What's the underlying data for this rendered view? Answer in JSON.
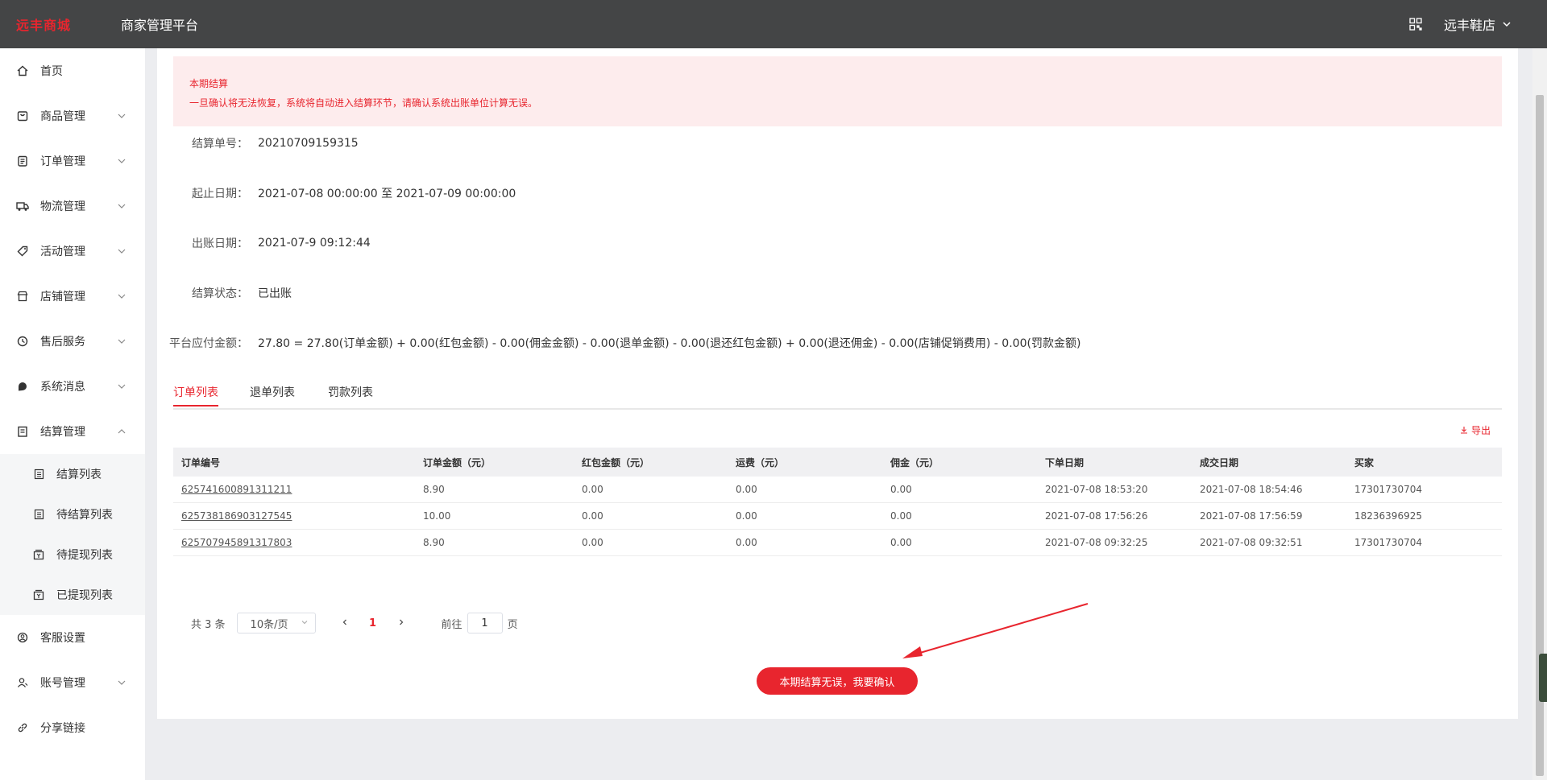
{
  "header": {
    "logo_text": "远丰商城",
    "platform_title": "商家管理平台",
    "store_name": "远丰鞋店"
  },
  "sidebar": {
    "items": [
      {
        "label": "首页",
        "icon": "home-icon"
      },
      {
        "label": "商品管理",
        "icon": "goods-icon"
      },
      {
        "label": "订单管理",
        "icon": "order-icon"
      },
      {
        "label": "物流管理",
        "icon": "truck-icon"
      },
      {
        "label": "活动管理",
        "icon": "tag-icon"
      },
      {
        "label": "店铺管理",
        "icon": "shop-icon"
      },
      {
        "label": "售后服务",
        "icon": "service-icon"
      },
      {
        "label": "系统消息",
        "icon": "message-icon"
      },
      {
        "label": "结算管理",
        "icon": "settlement-icon"
      }
    ],
    "settlement_sub": [
      {
        "label": "结算列表",
        "icon": "list-icon"
      },
      {
        "label": "待结算列表",
        "icon": "list-icon"
      },
      {
        "label": "待提现列表",
        "icon": "wallet-icon"
      },
      {
        "label": "已提现列表",
        "icon": "wallet-icon"
      }
    ],
    "bottom_items": [
      {
        "label": "客服设置",
        "icon": "customer-service-icon"
      },
      {
        "label": "账号管理",
        "icon": "account-icon"
      },
      {
        "label": "分享链接",
        "icon": "link-icon"
      }
    ]
  },
  "alert": {
    "title": "本期结算",
    "desc": "一旦确认将无法恢复，系统将自动进入结算环节，请确认系统出账单位计算无误。"
  },
  "info": {
    "bill_no_label": "结算单号：",
    "bill_no": "20210709159315",
    "period_label": "起止日期：",
    "period": "2021-07-08 00:00:00 至 2021-07-09 00:00:00",
    "bill_date_label": "出账日期：",
    "bill_date": "2021-07-9 09:12:44",
    "status_label": "结算状态：",
    "status": "已出账",
    "amount_label": "平台应付金额：",
    "amount": "27.80 = 27.80(订单金额) + 0.00(红包金额) - 0.00(佣金金额) - 0.00(退单金额) - 0.00(退还红包金额) + 0.00(退还佣金) - 0.00(店铺促销费用) - 0.00(罚款金额)"
  },
  "tabs": [
    "订单列表",
    "退单列表",
    "罚款列表"
  ],
  "export_label": "导出",
  "table": {
    "headers": [
      "订单编号",
      "订单金额（元）",
      "红包金额（元）",
      "运费（元）",
      "佣金（元）",
      "下单日期",
      "成交日期",
      "买家"
    ],
    "rows": [
      [
        "625741600891311211",
        "8.90",
        "0.00",
        "0.00",
        "0.00",
        "2021-07-08 18:53:20",
        "2021-07-08 18:54:46",
        "17301730704"
      ],
      [
        "625738186903127545",
        "10.00",
        "0.00",
        "0.00",
        "0.00",
        "2021-07-08 17:56:26",
        "2021-07-08 17:56:59",
        "18236396925"
      ],
      [
        "625707945891317803",
        "8.90",
        "0.00",
        "0.00",
        "0.00",
        "2021-07-08 09:32:25",
        "2021-07-08 09:32:51",
        "17301730704"
      ]
    ]
  },
  "pagination": {
    "total": "共 3 条",
    "page_size": "10条/页",
    "current_page": "1",
    "goto_prefix": "前往",
    "goto_value": "1",
    "goto_suffix": "页"
  },
  "confirm_button": "本期结算无误，我要确认",
  "colors": {
    "accent": "#e8252e",
    "topbar": "#444546",
    "alert_bg": "#fdeced"
  }
}
